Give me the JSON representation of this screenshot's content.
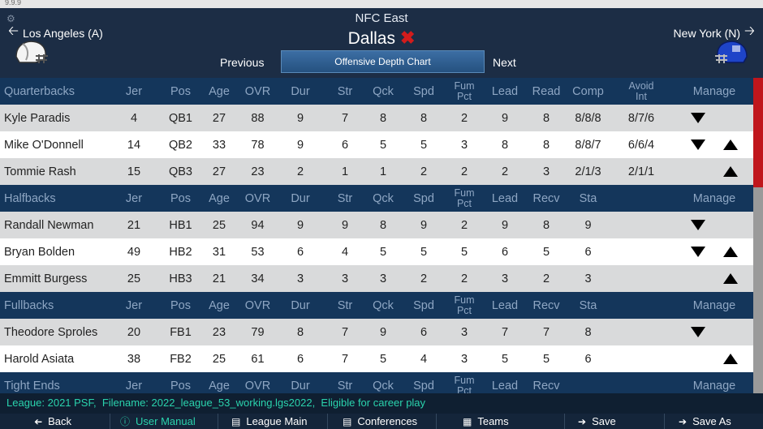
{
  "header": {
    "division": "NFC East",
    "team": "Dallas",
    "prev_team": "Los Angeles (A)",
    "next_team": "New York (N)",
    "previous_label": "Previous",
    "next_label": "Next",
    "chart_button": "Offensive Depth Chart"
  },
  "colors": {
    "accent_red": "#d21c1c",
    "section_bg": "#14365b",
    "status_text": "#2ad3ad"
  },
  "sections": [
    {
      "name": "Quarterbacks",
      "columns": [
        "Jer",
        "Pos",
        "Age",
        "OVR",
        "Dur",
        "Str",
        "Qck",
        "Spd",
        "Fum|Pct",
        "Lead",
        "Read",
        "Comp",
        "Avoid|Int",
        "",
        "Manage"
      ],
      "rows": [
        {
          "cells": [
            "Kyle Paradis",
            "4",
            "QB1",
            "27",
            "88",
            "9",
            "7",
            "8",
            "8",
            "2",
            "9",
            "8",
            "8/8/8",
            "8/7/6"
          ],
          "down": true,
          "up": false
        },
        {
          "cells": [
            "Mike O'Donnell",
            "14",
            "QB2",
            "33",
            "78",
            "9",
            "6",
            "5",
            "5",
            "3",
            "8",
            "8",
            "8/8/7",
            "6/6/4"
          ],
          "down": true,
          "up": true
        },
        {
          "cells": [
            "Tommie Rash",
            "15",
            "QB3",
            "27",
            "23",
            "2",
            "1",
            "1",
            "2",
            "2",
            "2",
            "3",
            "2/1/3",
            "2/1/1"
          ],
          "down": false,
          "up": true
        }
      ]
    },
    {
      "name": "Halfbacks",
      "columns": [
        "Jer",
        "Pos",
        "Age",
        "OVR",
        "Dur",
        "Str",
        "Qck",
        "Spd",
        "Fum|Pct",
        "Lead",
        "Recv",
        "Sta",
        "",
        "",
        "Manage"
      ],
      "rows": [
        {
          "cells": [
            "Randall Newman",
            "21",
            "HB1",
            "25",
            "94",
            "9",
            "9",
            "8",
            "9",
            "2",
            "9",
            "8",
            "9",
            ""
          ],
          "down": true,
          "up": false
        },
        {
          "cells": [
            "Bryan Bolden",
            "49",
            "HB2",
            "31",
            "53",
            "6",
            "4",
            "5",
            "5",
            "5",
            "6",
            "5",
            "6",
            ""
          ],
          "down": true,
          "up": true
        },
        {
          "cells": [
            "Emmitt Burgess",
            "25",
            "HB3",
            "21",
            "34",
            "3",
            "3",
            "3",
            "2",
            "2",
            "3",
            "2",
            "3",
            ""
          ],
          "down": false,
          "up": true
        }
      ]
    },
    {
      "name": "Fullbacks",
      "columns": [
        "Jer",
        "Pos",
        "Age",
        "OVR",
        "Dur",
        "Str",
        "Qck",
        "Spd",
        "Fum|Pct",
        "Lead",
        "Recv",
        "Sta",
        "",
        "",
        "Manage"
      ],
      "rows": [
        {
          "cells": [
            "Theodore Sproles",
            "20",
            "FB1",
            "23",
            "79",
            "8",
            "7",
            "9",
            "6",
            "3",
            "7",
            "7",
            "8",
            ""
          ],
          "down": true,
          "up": false
        },
        {
          "cells": [
            "Harold Asiata",
            "38",
            "FB2",
            "25",
            "61",
            "6",
            "7",
            "5",
            "4",
            "3",
            "5",
            "5",
            "6",
            ""
          ],
          "down": false,
          "up": true
        }
      ]
    },
    {
      "name": "Tight Ends",
      "columns": [
        "Jer",
        "Pos",
        "Age",
        "OVR",
        "Dur",
        "Str",
        "Qck",
        "Spd",
        "Fum|Pct",
        "Lead",
        "Recv",
        "",
        "",
        "",
        "Manage"
      ],
      "rows": []
    }
  ],
  "status": {
    "league": "League: 2021 PSF",
    "filename": "Filename: 2022_league_53_working.lgs2022",
    "eligibility": "Eligible for career play"
  },
  "bottom": [
    {
      "label": "Back",
      "icon": "back-arrow-icon"
    },
    {
      "label": "User Manual",
      "icon": "info-icon"
    },
    {
      "label": "League Main",
      "icon": "clipboard-icon"
    },
    {
      "label": "Conferences",
      "icon": "clipboard-icon"
    },
    {
      "label": "Teams",
      "icon": "teams-icon"
    },
    {
      "label": "Save",
      "icon": "save-arrow-icon"
    },
    {
      "label": "Save As",
      "icon": "save-as-arrow-icon"
    }
  ]
}
